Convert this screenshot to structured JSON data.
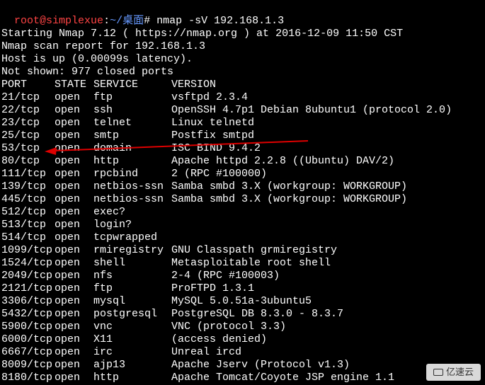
{
  "prompt": {
    "user": "root",
    "at": "@",
    "host": "simplexue",
    "sep1": ":",
    "path": "~/桌面",
    "sep2": "#",
    "command": " nmap -sV 192.168.1.3"
  },
  "intro": {
    "blank": "",
    "starting": "Starting Nmap 7.12 ( https://nmap.org ) at 2016-12-09 11:50 CST",
    "report": "Nmap scan report for 192.168.1.3",
    "host": "Host is up (0.00099s latency).",
    "notshown": "Not shown: 977 closed ports"
  },
  "header": {
    "port": "PORT",
    "state": "STATE",
    "service": "SERVICE",
    "version": "VERSION"
  },
  "rows": [
    {
      "port": "21/tcp",
      "state": "open",
      "service": "ftp",
      "version": "vsftpd 2.3.4"
    },
    {
      "port": "22/tcp",
      "state": "open",
      "service": "ssh",
      "version": "OpenSSH 4.7p1 Debian 8ubuntu1 (protocol 2.0)"
    },
    {
      "port": "23/tcp",
      "state": "open",
      "service": "telnet",
      "version": "Linux telnetd"
    },
    {
      "port": "25/tcp",
      "state": "open",
      "service": "smtp",
      "version": "Postfix smtpd"
    },
    {
      "port": "53/tcp",
      "state": "open",
      "service": "domain",
      "version": "ISC BIND 9.4.2"
    },
    {
      "port": "80/tcp",
      "state": "open",
      "service": "http",
      "version": "Apache httpd 2.2.8 ((Ubuntu) DAV/2)"
    },
    {
      "port": "111/tcp",
      "state": "open",
      "service": "rpcbind",
      "version": "2 (RPC #100000)"
    },
    {
      "port": "139/tcp",
      "state": "open",
      "service": "netbios-ssn",
      "version": "Samba smbd 3.X (workgroup: WORKGROUP)"
    },
    {
      "port": "445/tcp",
      "state": "open",
      "service": "netbios-ssn",
      "version": "Samba smbd 3.X (workgroup: WORKGROUP)"
    },
    {
      "port": "512/tcp",
      "state": "open",
      "service": "exec?",
      "version": ""
    },
    {
      "port": "513/tcp",
      "state": "open",
      "service": "login?",
      "version": ""
    },
    {
      "port": "514/tcp",
      "state": "open",
      "service": "tcpwrapped",
      "version": ""
    },
    {
      "port": "1099/tcp",
      "state": "open",
      "service": "rmiregistry",
      "version": "GNU Classpath grmiregistry"
    },
    {
      "port": "1524/tcp",
      "state": "open",
      "service": "shell",
      "version": "Metasploitable root shell"
    },
    {
      "port": "2049/tcp",
      "state": "open",
      "service": "nfs",
      "version": "2-4 (RPC #100003)"
    },
    {
      "port": "2121/tcp",
      "state": "open",
      "service": "ftp",
      "version": "ProFTPD 1.3.1"
    },
    {
      "port": "3306/tcp",
      "state": "open",
      "service": "mysql",
      "version": "MySQL 5.0.51a-3ubuntu5"
    },
    {
      "port": "5432/tcp",
      "state": "open",
      "service": "postgresql",
      "version": "PostgreSQL DB 8.3.0 - 8.3.7"
    },
    {
      "port": "5900/tcp",
      "state": "open",
      "service": "vnc",
      "version": "VNC (protocol 3.3)"
    },
    {
      "port": "6000/tcp",
      "state": "open",
      "service": "X11",
      "version": "(access denied)"
    },
    {
      "port": "6667/tcp",
      "state": "open",
      "service": "irc",
      "version": "Unreal ircd"
    },
    {
      "port": "8009/tcp",
      "state": "open",
      "service": "ajp13",
      "version": "Apache Jserv (Protocol v1.3)"
    },
    {
      "port": "8180/tcp",
      "state": "open",
      "service": "http",
      "version": "Apache Tomcat/Coyote JSP engine 1.1"
    }
  ],
  "annotation": {
    "arrow_color": "#dd0000"
  },
  "watermark": {
    "text": "亿速云"
  }
}
